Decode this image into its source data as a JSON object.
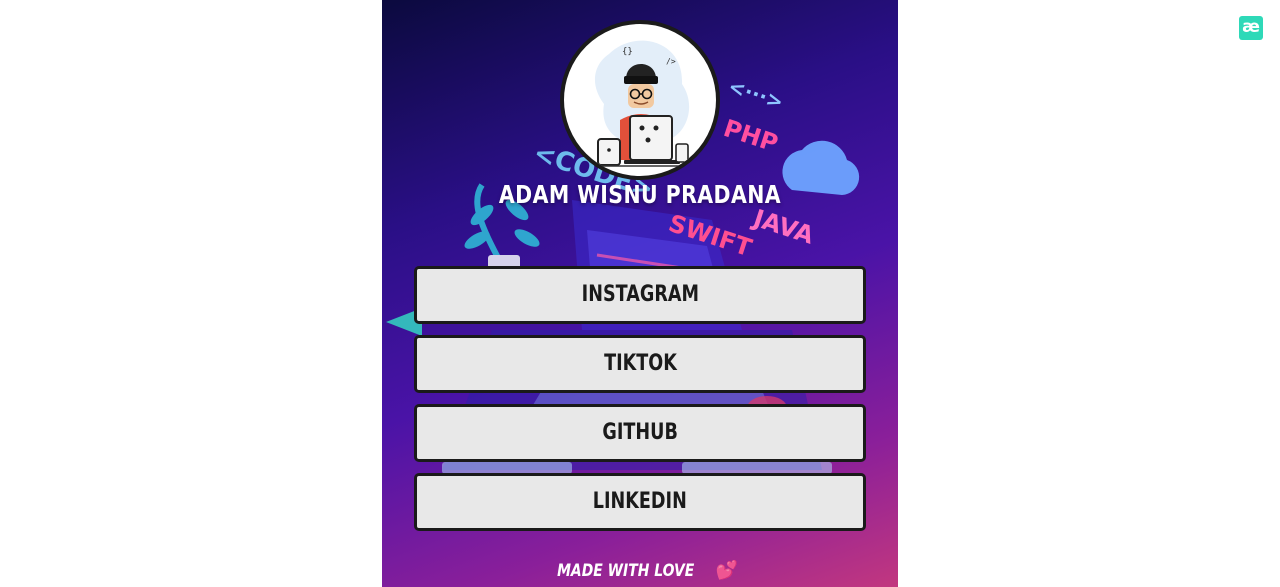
{
  "profile": {
    "name": "ADAM WISNU PRADANA"
  },
  "links": [
    {
      "label": "INSTAGRAM"
    },
    {
      "label": "TIKTOK"
    },
    {
      "label": "GITHUB"
    },
    {
      "label": "LINKEDIN"
    }
  ],
  "footer": {
    "text": "MADE WITH LOVE",
    "emoji": "💕"
  },
  "badge": {
    "glyph": "æ"
  },
  "background": {
    "code_words": [
      "<CODE>",
      "PHP",
      "JAVA",
      "SWIFT",
      "<···>"
    ]
  },
  "colors": {
    "button_bg": "#e8e8e8",
    "button_border": "#1a1a1a",
    "badge": "#2ed9b8",
    "gradient_start": "#0b0a3e",
    "gradient_end": "#c2377f"
  }
}
